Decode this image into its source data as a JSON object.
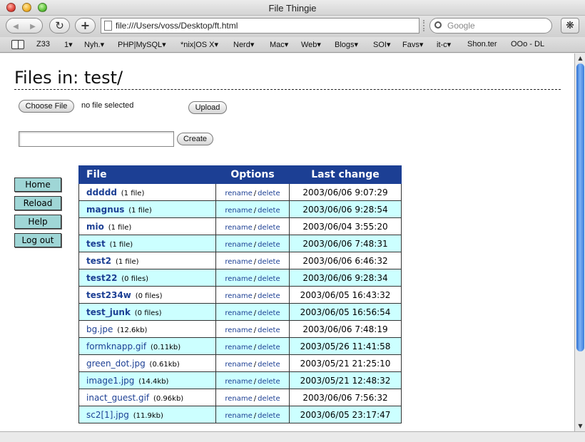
{
  "window": {
    "title": "File Thingie"
  },
  "toolbar": {
    "url": "file:///Users/voss/Desktop/ft.html",
    "search_placeholder": "Google"
  },
  "bookmarks": [
    "Z33",
    "1▾",
    "Nyh.▾",
    "PHP|MySQL▾",
    "*nix|OS X▾",
    "Nerd▾",
    "Mac▾",
    "Web▾",
    "Blogs▾",
    "SOI▾",
    "Favs▾",
    "it-c▾",
    "Shon.ter",
    "OOo - DL"
  ],
  "page": {
    "title": "Files in: test/",
    "choose_file_label": "Choose File",
    "no_file_text": "no file selected",
    "upload_label": "Upload",
    "create_label": "Create",
    "create_value": ""
  },
  "sidebar": [
    "Home",
    "Reload",
    "Help",
    "Log out"
  ],
  "table": {
    "headers": {
      "file": "File",
      "options": "Options",
      "last_change": "Last change"
    },
    "rename_label": "rename",
    "separator": "/",
    "delete_label": "delete",
    "rows": [
      {
        "name": "ddddd",
        "meta": "(1 file)",
        "date": "2003/06/06 9:07:29",
        "is_dir": true
      },
      {
        "name": "magnus",
        "meta": "(1 file)",
        "date": "2003/06/06 9:28:54",
        "is_dir": true
      },
      {
        "name": "mio",
        "meta": "(1 file)",
        "date": "2003/06/04 3:55:20",
        "is_dir": true
      },
      {
        "name": "test",
        "meta": "(1 file)",
        "date": "2003/06/06 7:48:31",
        "is_dir": true
      },
      {
        "name": "test2",
        "meta": "(1 file)",
        "date": "2003/06/06 6:46:32",
        "is_dir": true
      },
      {
        "name": "test22",
        "meta": "(0 files)",
        "date": "2003/06/06 9:28:34",
        "is_dir": true
      },
      {
        "name": "test234w",
        "meta": "(0 files)",
        "date": "2003/06/05 16:43:32",
        "is_dir": true
      },
      {
        "name": "test_junk",
        "meta": "(0 files)",
        "date": "2003/06/05 16:56:54",
        "is_dir": true
      },
      {
        "name": "bg.jpe",
        "meta": "(12.6kb)",
        "date": "2003/06/06 7:48:19",
        "is_dir": false
      },
      {
        "name": "formknapp.gif",
        "meta": "(0.11kb)",
        "date": "2003/05/26 11:41:58",
        "is_dir": false
      },
      {
        "name": "green_dot.jpg",
        "meta": "(0.61kb)",
        "date": "2003/05/21 21:25:10",
        "is_dir": false
      },
      {
        "name": "image1.jpg",
        "meta": "(14.4kb)",
        "date": "2003/05/21 12:48:32",
        "is_dir": false
      },
      {
        "name": "inact_guest.gif",
        "meta": "(0.96kb)",
        "date": "2003/06/06 7:56:32",
        "is_dir": false
      },
      {
        "name": "sc2[1].jpg",
        "meta": "(11.9kb)",
        "date": "2003/06/05 23:17:47",
        "is_dir": false
      }
    ]
  },
  "colors": {
    "header_bg": "#1c3f94",
    "row_alt": "#ccffff",
    "sidebar_btn": "#9fd6d6",
    "link": "#1c3f94"
  }
}
